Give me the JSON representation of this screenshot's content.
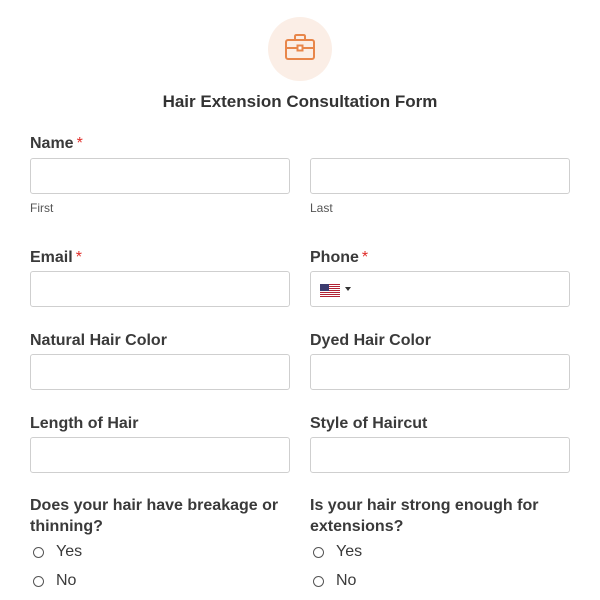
{
  "icons": {
    "logo": "briefcase-icon",
    "flag": "us-flag-icon",
    "dropdown": "caret-down-icon"
  },
  "colors": {
    "accent": "#e8864a",
    "accent_bg": "#fbeee6",
    "required": "#e02b27",
    "border": "#cfcfcf"
  },
  "form": {
    "title": "Hair Extension Consultation Form",
    "required_mark": "*",
    "name": {
      "label": "Name",
      "first_value": "",
      "last_value": "",
      "first_sublabel": "First",
      "last_sublabel": "Last"
    },
    "email": {
      "label": "Email",
      "value": ""
    },
    "phone": {
      "label": "Phone",
      "value": ""
    },
    "natural_hair_color": {
      "label": "Natural Hair Color",
      "value": ""
    },
    "dyed_hair_color": {
      "label": "Dyed Hair Color",
      "value": ""
    },
    "length_of_hair": {
      "label": "Length of Hair",
      "value": ""
    },
    "style_of_haircut": {
      "label": "Style of Haircut",
      "value": ""
    },
    "breakage": {
      "label": "Does your hair have breakage or thinning?",
      "options": [
        "Yes",
        "No"
      ]
    },
    "strong_enough": {
      "label": "Is your hair strong enough for extensions?",
      "options": [
        "Yes",
        "No"
      ]
    }
  }
}
